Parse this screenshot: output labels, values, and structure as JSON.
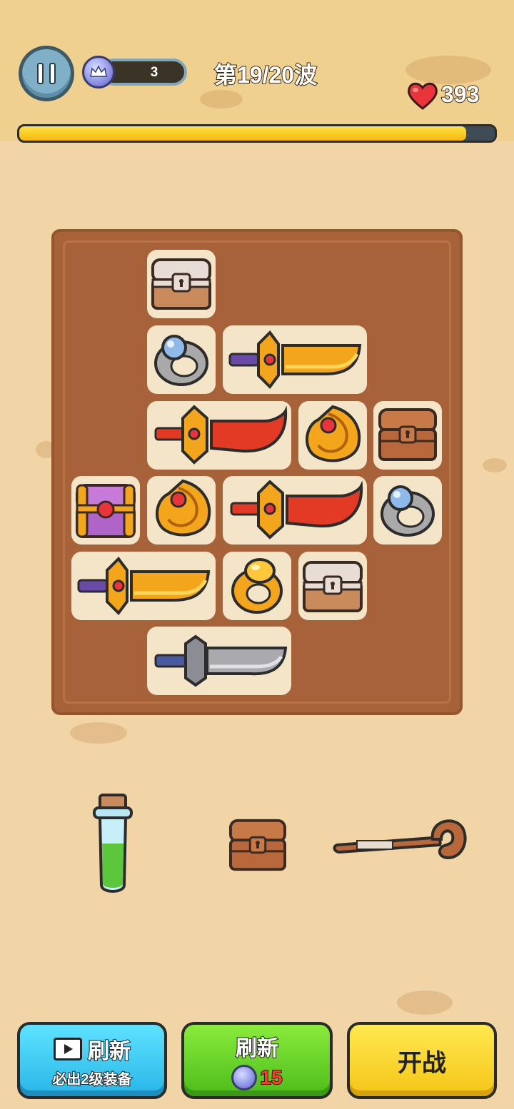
{
  "hud": {
    "crown_count": "3",
    "wave_label": "第19/20波",
    "hp": "393",
    "wave_progress": 0.94
  },
  "board": {
    "items": [
      {
        "name": "chest-white-icon"
      },
      {
        "name": "silver-ring-icon"
      },
      {
        "name": "golden-sword-icon"
      },
      {
        "name": "crimson-sword-icon"
      },
      {
        "name": "golden-amulet-icon"
      },
      {
        "name": "chest-brown-icon"
      },
      {
        "name": "chest-purple-icon"
      },
      {
        "name": "golden-amulet-icon"
      },
      {
        "name": "crimson-sword-icon"
      },
      {
        "name": "silver-ring-icon"
      },
      {
        "name": "golden-sword-icon"
      },
      {
        "name": "gold-ring-icon"
      },
      {
        "name": "chest-white-icon"
      },
      {
        "name": "iron-sword-icon"
      }
    ]
  },
  "shop": {
    "items": [
      {
        "name": "green-potion-icon"
      },
      {
        "name": "chest-brown-icon"
      },
      {
        "name": "wooden-staff-icon"
      }
    ]
  },
  "buttons": {
    "ad_refresh_label": "刷新",
    "ad_refresh_sub": "必出2级装备",
    "refresh_label": "刷新",
    "refresh_cost": "15",
    "fight_label": "开战"
  },
  "colors": {
    "top_bar": "#f0d08e",
    "background": "#f1d5a6",
    "board": "#a7623a",
    "cell": "#f4e5c8"
  }
}
